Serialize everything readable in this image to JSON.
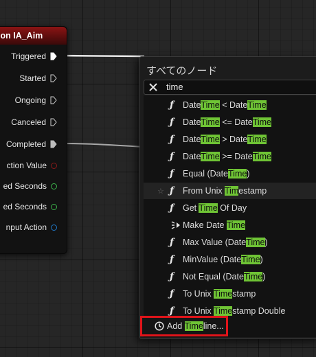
{
  "node": {
    "title": "ion IA_Aim",
    "pins": {
      "triggered": "Triggered",
      "started": "Started",
      "ongoing": "Ongoing",
      "canceled": "Canceled",
      "completed": "Completed",
      "action_value": "ction Value",
      "elapsed_seconds": "ed Seconds",
      "triggered_seconds": "ed Seconds",
      "input_action": "nput Action"
    }
  },
  "menu": {
    "title": "すべてのノード",
    "search_value": "time",
    "items": [
      {
        "pre": "Date",
        "m1": "Time",
        "mid": " < Date",
        "m2": "Time",
        "post": ""
      },
      {
        "pre": "Date",
        "m1": "Time",
        "mid": " <= Date",
        "m2": "Time",
        "post": ""
      },
      {
        "pre": "Date",
        "m1": "Time",
        "mid": " > Date",
        "m2": "Time",
        "post": ""
      },
      {
        "pre": "Date",
        "m1": "Time",
        "mid": " >= Date",
        "m2": "Time",
        "post": ""
      },
      {
        "pre": "Equal (Date",
        "m1": "Time",
        "mid": ")",
        "m2": "",
        "post": ""
      },
      {
        "pre": "From Unix ",
        "m1": "Tim",
        "mid": "estamp",
        "m2": "",
        "post": ""
      },
      {
        "pre": "Get ",
        "m1": "Time",
        "mid": " Of Day",
        "m2": "",
        "post": ""
      },
      {
        "pre": "Make Date ",
        "m1": "Time",
        "mid": "",
        "m2": "",
        "post": ""
      },
      {
        "pre": "Max Value (Date",
        "m1": "Time",
        "mid": ")",
        "m2": "",
        "post": ""
      },
      {
        "pre": "MinValue (Date",
        "m1": "Time",
        "mid": ")",
        "m2": "",
        "post": ""
      },
      {
        "pre": "Not Equal (Date",
        "m1": "Time",
        "mid": ")",
        "m2": "",
        "post": ""
      },
      {
        "pre": "To Unix ",
        "m1": "Time",
        "mid": "stamp",
        "m2": "",
        "post": ""
      },
      {
        "pre": "To Unix ",
        "m1": "Time",
        "mid": "stamp Double",
        "m2": "",
        "post": ""
      }
    ],
    "function_glyph": "ƒ",
    "star_glyph": "☆",
    "timeline": {
      "pre": "Add ",
      "m1": "Time",
      "post": "line..."
    }
  },
  "icons": {
    "clear": "close-icon",
    "function": "function-icon",
    "favorite": "star-icon",
    "make_datetime": "make-struct-icon",
    "timeline": "clock-icon"
  },
  "colors": {
    "highlight": "#6fc435",
    "node_header": "#8c1414",
    "annotation_box": "#e0141a",
    "exec_pin": "#ffffff",
    "action_value_pin": "#8b1a1a",
    "seconds_pin": "#3cb44b",
    "input_action_pin": "#1f78c8"
  }
}
